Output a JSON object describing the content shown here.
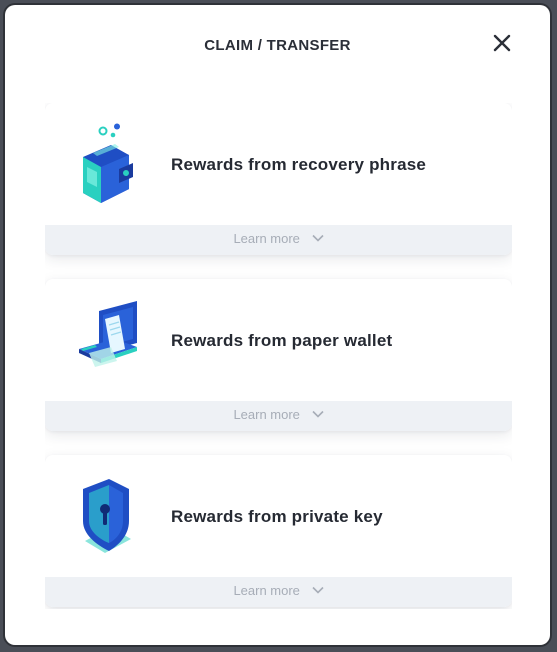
{
  "modal": {
    "title": "CLAIM / TRANSFER",
    "close_icon": "close-icon"
  },
  "options": [
    {
      "label": "Rewards from recovery phrase",
      "learn_more": "Learn more",
      "icon": "wallet-icon"
    },
    {
      "label": "Rewards from paper wallet",
      "learn_more": "Learn more",
      "icon": "paper-wallet-icon"
    },
    {
      "label": "Rewards from private key",
      "learn_more": "Learn more",
      "icon": "shield-key-icon"
    }
  ],
  "colors": {
    "accent_blue": "#2a62d9",
    "teal": "#2ad0c0",
    "text": "#262a33",
    "muted": "#a7adb7",
    "footer_bg": "#eef1f5"
  }
}
